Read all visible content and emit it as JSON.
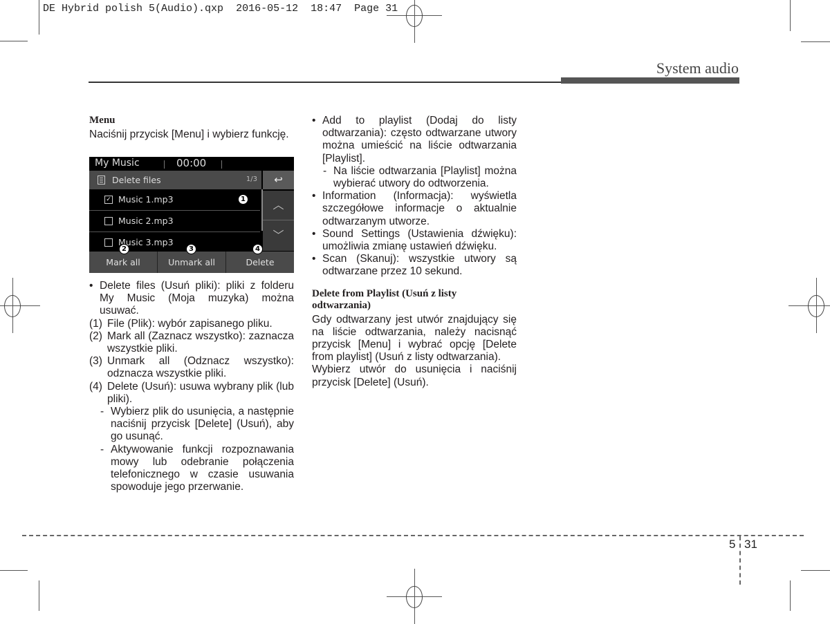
{
  "slug": {
    "filename": "DE Hybrid polish 5(Audio).qxp",
    "date": "2016-05-12",
    "time": "18:47",
    "page": "Page 31"
  },
  "header": {
    "section_title": "System audio"
  },
  "left_column": {
    "heading": "Menu",
    "intro": "Naciśnij przycisk [Menu] i wybierz funkcję.",
    "bullet": "Delete files (Usuń pliki): pliki z folderu My Music (Moja muzyka) można usuwać.",
    "numbered": [
      {
        "marker": "(1)",
        "text": "File (Plik): wybór zapisanego pliku."
      },
      {
        "marker": "(2)",
        "text": "Mark all (Zaznacz wszystko): zaznacza wszystkie pliki."
      },
      {
        "marker": "(3)",
        "text": "Unmark all (Odznacz wszystko): odznacza wszystkie pliki."
      },
      {
        "marker": "(4)",
        "text": "Delete (Usuń): usuwa wybrany plik (lub pliki)."
      }
    ],
    "dashes": [
      "Wybierz plik do usunięcia, a następnie naciśnij przycisk [Delete] (Usuń), aby go usunąć.",
      "Aktywowanie funkcji rozpoznawania mowy lub odebranie połączenia telefonicznego w czasie usuwania spowoduje jego przerwanie."
    ]
  },
  "screen": {
    "title": "My Music",
    "time": "00:00",
    "menu_label": "Delete files",
    "page_indicator": "1/3",
    "back_icon": "↩",
    "files": [
      {
        "name": "Music 1.mp3",
        "checked": true,
        "check_glyph": "✓"
      },
      {
        "name": "Music 2.mp3",
        "checked": false,
        "check_glyph": ""
      },
      {
        "name": "Music 3.mp3",
        "checked": false,
        "check_glyph": ""
      }
    ],
    "scroll_up_icon": "︿",
    "scroll_down_icon": "﹀",
    "buttons": [
      "Mark all",
      "Unmark all",
      "Delete"
    ],
    "callouts": [
      "1",
      "2",
      "3",
      "4"
    ]
  },
  "right_column": {
    "bullets": [
      "Add to playlist (Dodaj do listy odtwarzania): często odtwarzane utwory można umieścić na liście odtwarzania [Playlist].",
      "Information (Informacja): wyświetla szczegółowe informacje o aktualnie odtwarzanym utworze.",
      "Sound Settings (Ustawienia dźwięku): umożliwia zmianę ustawień dźwięku.",
      "Scan (Skanuj): wszystkie utwory są odtwarzane przez 10 sekund."
    ],
    "playlist_dash": "Na liście odtwarzania [Playlist] można wybierać utwory do odtworzenia.",
    "heading": "Delete from Playlist (Usuń z listy odtwarzania)",
    "para1": "Gdy odtwarzany jest utwór znajdujący się na liście odtwarzania, należy nacisnąć przycisk [Menu] i wybrać opcję [Delete from playlist] (Usuń z listy odtwarzania).",
    "para2": "Wybierz utwór do usunięcia i naciśnij przycisk [Delete] (Usuń)."
  },
  "footer": {
    "chapter": "5",
    "page": "31"
  }
}
